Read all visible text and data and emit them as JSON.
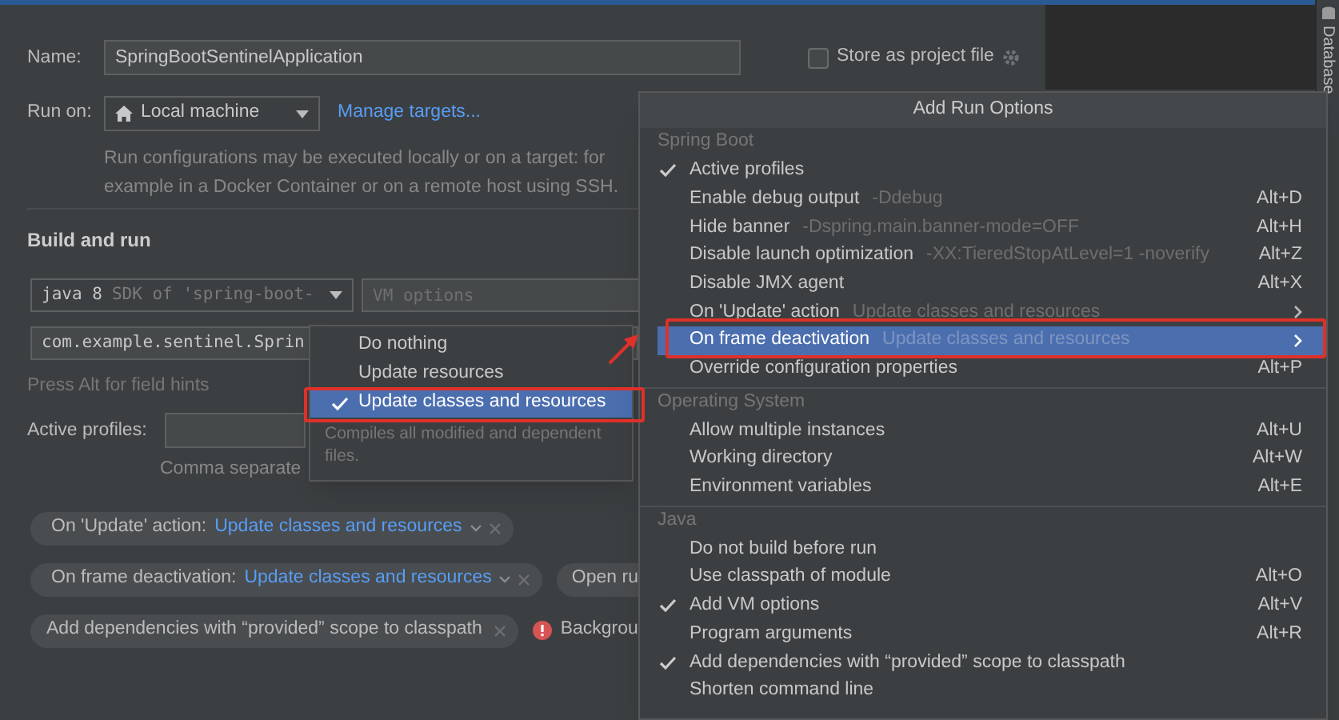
{
  "name_field": {
    "label": "Name:",
    "value": "SpringBootSentinelApplication"
  },
  "store_as_project_file": {
    "label": "Store as project file",
    "checked": false
  },
  "run_on": {
    "label": "Run on:",
    "value": "Local machine",
    "link": "Manage targets...",
    "description": "Run configurations may be executed locally or on a target: for example in a Docker Container or on a remote host using SSH."
  },
  "build_and_run": {
    "title": "Build and run",
    "sdk": {
      "value": "java 8",
      "hint": "SDK of 'spring-boot-"
    },
    "vm_options": {
      "placeholder": "VM options"
    },
    "main_class": {
      "value": "com.example.sentinel.Sprin"
    },
    "hint": "Press Alt for field hints"
  },
  "active_profiles": {
    "label": "Active profiles:",
    "hint": "Comma separate"
  },
  "chip_rows": [
    {
      "chips": [
        {
          "kind": "option",
          "label": "On 'Update' action:",
          "value": "Update classes and resources"
        }
      ]
    },
    {
      "chips": [
        {
          "kind": "option",
          "label": "On frame deactivation:",
          "value": "Update classes and resources"
        },
        {
          "kind": "plain",
          "label": "Open ru"
        }
      ]
    },
    {
      "chips": [
        {
          "kind": "removable",
          "label": "Add dependencies with “provided” scope to classpath"
        },
        {
          "kind": "warning",
          "label": "Backgrou"
        }
      ]
    }
  ],
  "update_dropdown": {
    "items": [
      {
        "label": "Do nothing",
        "selected": false
      },
      {
        "label": "Update resources",
        "selected": false
      },
      {
        "label": "Update classes and resources",
        "selected": true
      }
    ],
    "description": "Compiles all modified and dependent files."
  },
  "run_options_popup": {
    "title": "Add Run Options",
    "sections": [
      {
        "header": "Spring Boot",
        "items": [
          {
            "label": "Active profiles",
            "checked": true,
            "selected": false,
            "submenu": false
          },
          {
            "label": "Enable debug output",
            "hint": "-Ddebug",
            "shortcut": "Alt+D",
            "checked": false,
            "selected": false,
            "submenu": false
          },
          {
            "label": "Hide banner",
            "hint": "-Dspring.main.banner-mode=OFF",
            "shortcut": "Alt+H",
            "checked": false,
            "selected": false,
            "submenu": false
          },
          {
            "label": "Disable launch optimization",
            "hint": "-XX:TieredStopAtLevel=1 -noverify",
            "shortcut": "Alt+Z",
            "checked": false,
            "selected": false,
            "submenu": false
          },
          {
            "label": "Disable JMX agent",
            "shortcut": "Alt+X",
            "checked": false,
            "selected": false,
            "submenu": false
          },
          {
            "label": "On 'Update' action",
            "hint": "Update classes and resources",
            "checked": false,
            "selected": false,
            "submenu": true
          },
          {
            "label": "On frame deactivation",
            "hint": "Update classes and resources",
            "checked": false,
            "selected": true,
            "submenu": true
          },
          {
            "label": "Override configuration properties",
            "shortcut": "Alt+P",
            "checked": false,
            "selected": false,
            "submenu": false
          }
        ]
      },
      {
        "header": "Operating System",
        "items": [
          {
            "label": "Allow multiple instances",
            "shortcut": "Alt+U",
            "checked": false,
            "selected": false,
            "submenu": false
          },
          {
            "label": "Working directory",
            "shortcut": "Alt+W",
            "checked": false,
            "selected": false,
            "submenu": false
          },
          {
            "label": "Environment variables",
            "shortcut": "Alt+E",
            "checked": false,
            "selected": false,
            "submenu": false
          }
        ]
      },
      {
        "header": "Java",
        "items": [
          {
            "label": "Do not build before run",
            "checked": false,
            "selected": false,
            "submenu": false
          },
          {
            "label": "Use classpath of module",
            "shortcut": "Alt+O",
            "checked": false,
            "selected": false,
            "submenu": false
          },
          {
            "label": "Add VM options",
            "shortcut": "Alt+V",
            "checked": true,
            "selected": false,
            "submenu": false
          },
          {
            "label": "Program arguments",
            "shortcut": "Alt+R",
            "checked": false,
            "selected": false,
            "submenu": false
          },
          {
            "label": "Add dependencies with “provided” scope to classpath",
            "checked": true,
            "selected": false,
            "submenu": false
          },
          {
            "label": "Shorten command line",
            "checked": false,
            "selected": false,
            "submenu": false
          }
        ]
      }
    ]
  },
  "side_tool_window": {
    "label": "Database"
  }
}
